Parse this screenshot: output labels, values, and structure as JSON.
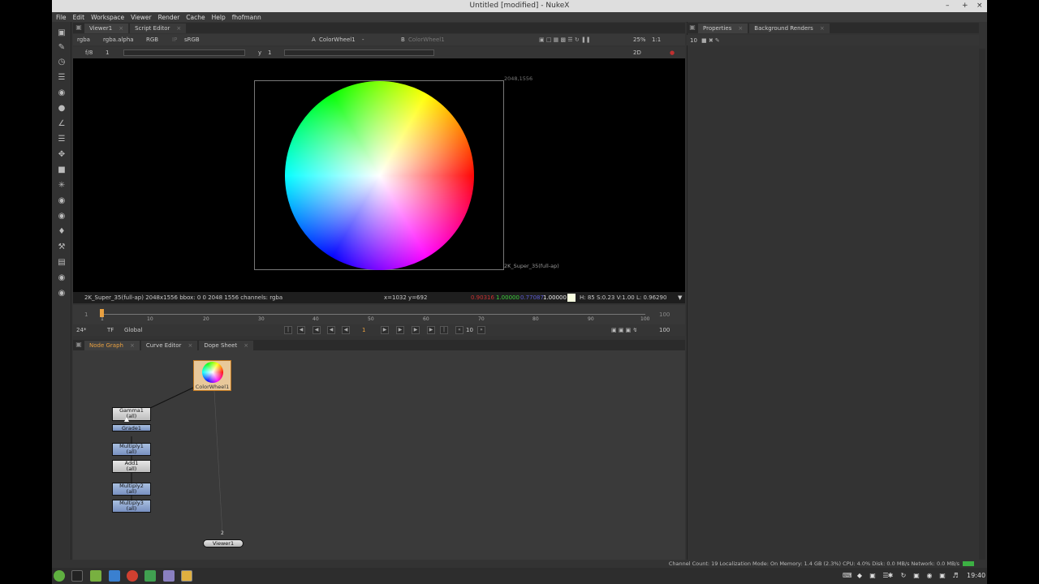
{
  "window": {
    "title": "Untitled [modified] - NukeX"
  },
  "menu": [
    "File",
    "Edit",
    "Workspace",
    "Viewer",
    "Render",
    "Cache",
    "Help",
    "fhofmann"
  ],
  "viewer_tabs": [
    {
      "label": "Viewer1"
    },
    {
      "label": "Script Editor"
    }
  ],
  "viewer_controls": {
    "channels": "rgba",
    "alpha": "rgba.alpha",
    "display": "RGB",
    "ip": "IP",
    "lut": "sRGB",
    "input_a_letter": "A",
    "input_a": "ColorWheel1",
    "input_a_op": "-",
    "input_b_letter": "B",
    "input_b": "ColorWheel1",
    "zoom": "25%",
    "ratio": "1:1",
    "frame_step": "f/8",
    "frame_value": "1",
    "y_label": "y",
    "y_value": "1",
    "view_mode": "2D"
  },
  "viewer": {
    "corner_label": "2048,1556",
    "format_label": "2K_Super_35(full-ap)"
  },
  "info_bar": {
    "format": "2K_Super_35(full-ap) 2048x1556  bbox: 0 0 2048 1556 channels: rgba",
    "coords": "x=1032 y=692",
    "r": "0.90316",
    "g": "1.00000",
    "b": "0.77087",
    "a": "1.00000",
    "hsvl": "H: 85 S:0.23 V:1.00  L: 0.96290"
  },
  "timeline": {
    "start": "1",
    "end": "100",
    "ticks": [
      "1",
      "10",
      "20",
      "30",
      "40",
      "50",
      "60",
      "70",
      "80",
      "90",
      "100"
    ],
    "fps": "24*",
    "tf": "TF",
    "range": "Global",
    "current_frame": "1",
    "step": "10",
    "end_field": "100"
  },
  "graph_tabs": [
    {
      "label": "Node Graph"
    },
    {
      "label": "Curve Editor"
    },
    {
      "label": "Dope Sheet"
    }
  ],
  "nodes": {
    "colorwheel": "ColorWheel1",
    "gamma": "Gamma1",
    "gamma_sub": "(all)",
    "grade": "Grade1",
    "multiply1": "Multiply1",
    "multiply1_sub": "(all)",
    "add1": "Add1",
    "add1_sub": "(all)",
    "multiply2": "Multiply2",
    "multiply2_sub": "(all)",
    "multiply3": "Multiply3",
    "multiply3_sub": "(all)",
    "viewer_input": "2",
    "viewer": "Viewer1"
  },
  "props_tabs": [
    {
      "label": "Properties"
    },
    {
      "label": "Background Renders"
    }
  ],
  "props_count": "10",
  "status": "Channel Count: 19  Localization Mode: On  Memory: 1.4 GB (2.3%) CPU: 4.0% Disk: 0.0 MB/s Network: 0.0 MB/s",
  "clock": "19:40",
  "colors": {
    "accent_orange": "#e8a040",
    "node_blue": "#8ca4d0",
    "node_grey": "#d0d0d0"
  }
}
